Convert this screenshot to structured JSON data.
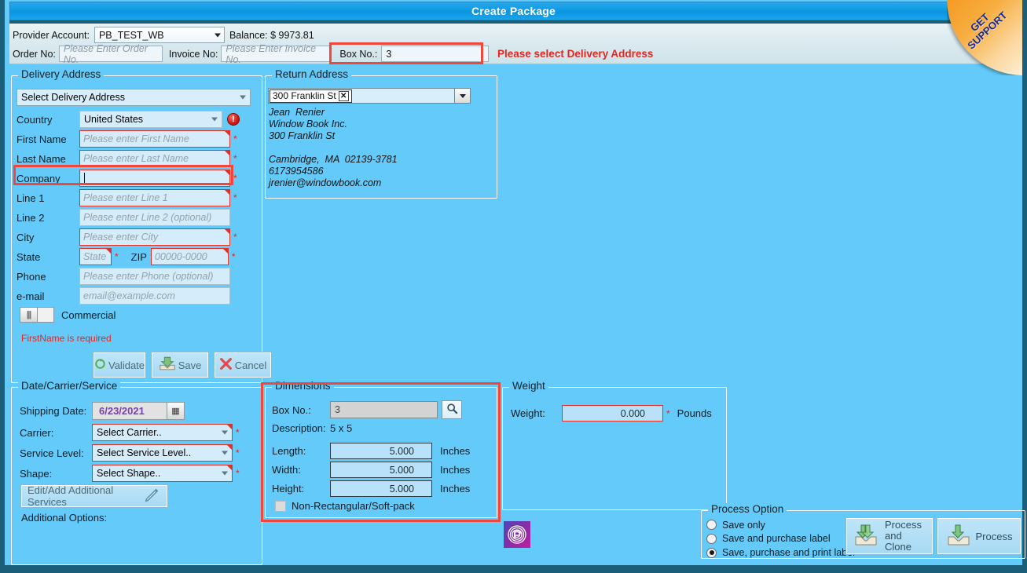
{
  "window": {
    "title": "Create Package"
  },
  "support_ribbon": {
    "line1": "GET",
    "line2": "SUPPORT"
  },
  "toolbar": {
    "provider_account_label": "Provider Account:",
    "provider_account_value": "PB_TEST_WB",
    "balance_label": "Balance: $  9973.81",
    "order_no_label": "Order No:",
    "order_no_placeholder": "Please Enter Order No.",
    "invoice_no_label": "Invoice No:",
    "invoice_no_placeholder": "Please Enter Invoice No.",
    "box_no_label": "Box No.:",
    "box_no_value": "3",
    "warning": "Please select Delivery Address"
  },
  "delivery_address": {
    "legend": "Delivery Address",
    "select_placeholder": "Select Delivery Address",
    "country_label": "Country",
    "country_value": "United States",
    "first_name_label": "First Name",
    "first_name_placeholder": "Please enter First Name",
    "last_name_label": "Last Name",
    "last_name_placeholder": "Please enter Last Name",
    "company_label": "Company",
    "company_value": "",
    "line1_label": "Line 1",
    "line1_placeholder": "Please enter Line 1",
    "line2_label": "Line 2",
    "line2_placeholder": "Please enter Line 2 (optional)",
    "city_label": "City",
    "city_placeholder": "Please enter City",
    "state_label": "State",
    "state_placeholder": "State",
    "zip_label": "ZIP",
    "zip_placeholder": "00000-0000",
    "phone_label": "Phone",
    "phone_placeholder": "Please enter Phone (optional)",
    "email_label": "e-mail",
    "email_placeholder": "email@example.com",
    "commercial_label": "Commercial",
    "error_message": "FirstName is required",
    "validate_button": "Validate",
    "save_button": "Save",
    "cancel_button": "Cancel",
    "required_marker": "*"
  },
  "return_address": {
    "legend": "Return Address",
    "selected_tag": "300 Franklin St",
    "lines": [
      "Jean  Renier",
      "Window Book Inc.",
      "300 Franklin St",
      "",
      "Cambridge,  MA  02139-3781",
      "6173954586",
      "jrenier@windowbook.com"
    ]
  },
  "date_carrier_service": {
    "legend": "Date/Carrier/Service",
    "shipping_date_label": "Shipping Date:",
    "shipping_date_value": "6/23/2021",
    "carrier_label": "Carrier:",
    "carrier_placeholder": "Select Carrier..",
    "service_level_label": "Service Level:",
    "service_level_placeholder": "Select Service Level..",
    "shape_label": "Shape:",
    "shape_placeholder": "Select Shape..",
    "edit_services_button": "Edit/Add Additional Services",
    "additional_options_label": "Additional Options:"
  },
  "dimensions": {
    "legend": "Dimensions",
    "box_no_label": "Box No.:",
    "box_no_value": "3",
    "description_label": "Description:",
    "description_value": "5 x 5",
    "length_label": "Length:",
    "length_value": "5.000",
    "width_label": "Width:",
    "width_value": "5.000",
    "height_label": "Height:",
    "height_value": "5.000",
    "unit": "Inches",
    "non_rect_label": "Non-Rectangular/Soft-pack"
  },
  "weight": {
    "legend": "Weight",
    "weight_label": "Weight:",
    "weight_value": "0.000",
    "unit": "Pounds",
    "required_marker": "*"
  },
  "process_option": {
    "legend": "Process Option",
    "options": [
      {
        "label": "Save only",
        "selected": false
      },
      {
        "label": "Save and purchase label",
        "selected": false
      },
      {
        "label": "Save, purchase and print label",
        "selected": true
      }
    ],
    "process_and_clone_button_line1": "Process",
    "process_and_clone_button_line2": "and Clone",
    "process_button": "Process"
  },
  "colors": {
    "background": "#63caf9",
    "frame": "#1b5e7a",
    "titlebar": "#0c9ae4",
    "highlight": "#f0473c",
    "error_text": "#e8251c",
    "required_border": "#e03127",
    "date_text": "#7a3fb0"
  }
}
